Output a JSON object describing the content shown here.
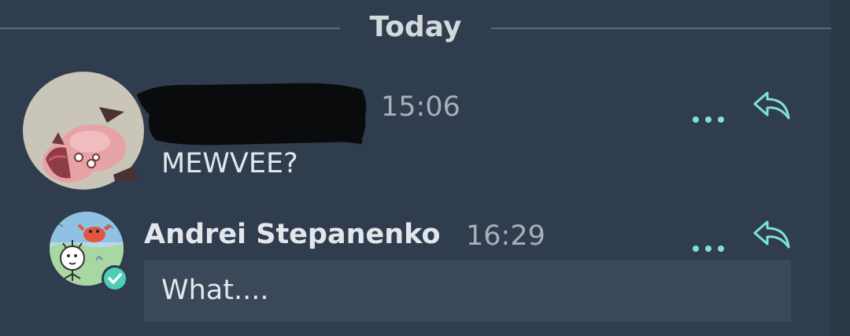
{
  "theme": {
    "background": "#2f3d4e",
    "bubble": "#3a4859",
    "accent": "#7fe1d6",
    "verified": "#4ecdb8"
  },
  "divider": {
    "label": "Today"
  },
  "messages": [
    {
      "sender": "",
      "sender_redacted": true,
      "time": "15:06",
      "text": "MEWVEE?",
      "avatar_icon": "pig-fish-avatar"
    },
    {
      "sender": "Andrei Stepanenko",
      "time": "16:29",
      "text": "What....",
      "verified": true,
      "avatar_icon": "crab-doodle-avatar"
    }
  ],
  "actions": {
    "more_icon": "ellipsis-icon",
    "reply_icon": "reply-arrow-icon"
  }
}
